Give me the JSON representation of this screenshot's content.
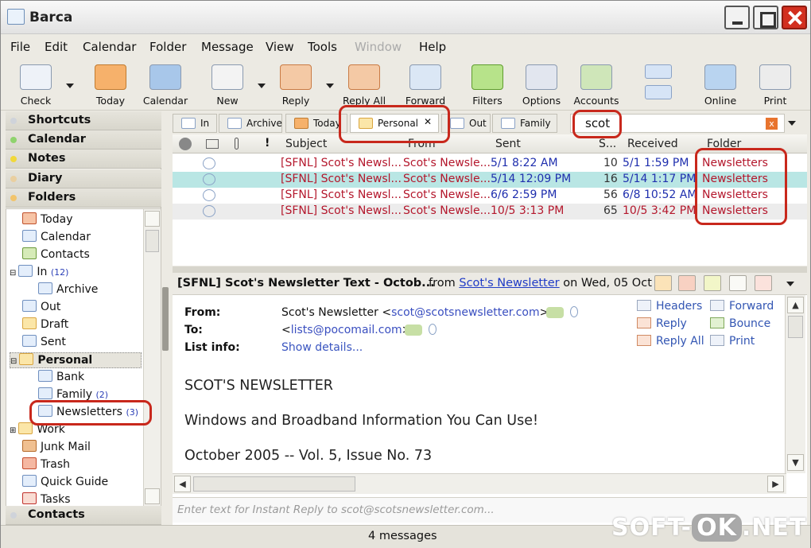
{
  "window": {
    "title": "Barca"
  },
  "menu": [
    "File",
    "Edit",
    "Calendar",
    "Folder",
    "Message",
    "View",
    "Tools",
    "Window",
    "Help"
  ],
  "toolbar": [
    "Check",
    "Today",
    "Calendar",
    "New",
    "Reply",
    "Reply All",
    "Forward",
    "Filters",
    "Options",
    "Accounts",
    "Online",
    "Print"
  ],
  "sidebar": {
    "sections": [
      "Shortcuts",
      "Calendar",
      "Notes",
      "Diary",
      "Folders"
    ],
    "tree": [
      {
        "label": "Today",
        "count": ""
      },
      {
        "label": "Calendar",
        "count": ""
      },
      {
        "label": "Contacts",
        "count": ""
      },
      {
        "label": "In",
        "count": "(12)"
      },
      {
        "label": "Archive",
        "count": ""
      },
      {
        "label": "Out",
        "count": ""
      },
      {
        "label": "Draft",
        "count": ""
      },
      {
        "label": "Sent",
        "count": ""
      },
      {
        "label": "Personal",
        "count": ""
      },
      {
        "label": "Bank",
        "count": ""
      },
      {
        "label": "Family",
        "count": "(2)"
      },
      {
        "label": "Newsletters",
        "count": "(3)"
      },
      {
        "label": "Work",
        "count": ""
      },
      {
        "label": "Junk Mail",
        "count": ""
      },
      {
        "label": "Trash",
        "count": ""
      },
      {
        "label": "Quick Guide",
        "count": ""
      },
      {
        "label": "Tasks",
        "count": ""
      }
    ],
    "contacts_section": "Contacts"
  },
  "tabs": [
    "In",
    "Archive",
    "Today",
    "Personal",
    "Out",
    "Family"
  ],
  "close_glyph": "✕",
  "search": {
    "value": "scot"
  },
  "columns": [
    "Subject",
    "From",
    "Sent",
    "S...",
    "Received",
    "Folder"
  ],
  "messages": [
    {
      "subject": "[SFNL] Scot's Newsl...",
      "from": "Scot's Newsle...",
      "sent": "5/1 8:22 AM",
      "size": "10",
      "received": "5/1 1:59 PM",
      "folder": "Newsletters"
    },
    {
      "subject": "[SFNL] Scot's Newsl...",
      "from": "Scot's Newsle...",
      "sent": "5/14 12:09 PM",
      "size": "16",
      "received": "5/14 1:17 PM",
      "folder": "Newsletters"
    },
    {
      "subject": "[SFNL] Scot's Newsl...",
      "from": "Scot's Newsle...",
      "sent": "6/6 2:59 PM",
      "size": "56",
      "received": "6/8 10:52 AM",
      "folder": "Newsletters"
    },
    {
      "subject": "[SFNL] Scot's Newsl...",
      "from": "Scot's Newsle...",
      "sent": "10/5 3:13 PM",
      "size": "65",
      "received": "10/5 3:42 PM",
      "folder": "Newsletters"
    }
  ],
  "preview": {
    "subject": "[SFNL] Scot's Newsletter Text - Octob...",
    "from_prefix": "from",
    "from_link": "Scot's Newsletter",
    "date": "on Wed, 05 Oct",
    "labels": {
      "from": "From:",
      "to": "To:",
      "list": "List info:"
    },
    "from_value": "Scot's Newsletter <",
    "from_email": "scot@scotsnewsletter.com",
    "from_close": ">",
    "to_open": "<",
    "to_email": "lists@pocomail.com",
    "to_close": ">",
    "list_value": "Show details...",
    "actions": [
      "Headers",
      "Forward",
      "Reply",
      "Bounce",
      "Reply All",
      "Print"
    ],
    "body": [
      "SCOT'S NEWSLETTER",
      "Windows and Broadband Information You Can Use!",
      "October 2005 -- Vol. 5, Issue No. 73"
    ],
    "reply_placeholder": "Enter text for Instant Reply to scot@scotsnewsletter.com..."
  },
  "status": "4 messages",
  "watermark": {
    "a": "SOFT-",
    "b": "OK",
    ".": ".NET"
  }
}
